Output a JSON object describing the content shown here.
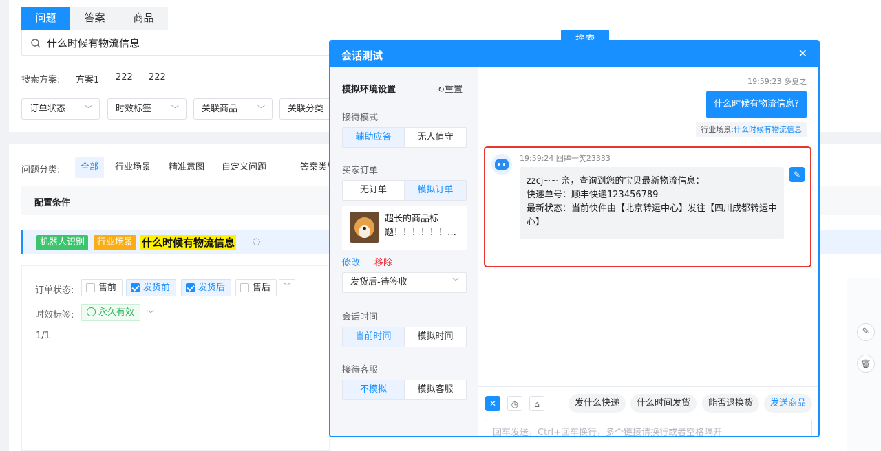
{
  "top_tabs": [
    "问题",
    "答案",
    "商品"
  ],
  "search": {
    "value": "什么时候有物流信息",
    "button_label": "搜索"
  },
  "search_plan": {
    "label": "搜索方案:",
    "items": [
      "方案1",
      "222",
      "222"
    ]
  },
  "filters": [
    "订单状态",
    "时效标签",
    "关联商品",
    "关联分类"
  ],
  "categories": {
    "label": "问题分类:",
    "items": [
      "全部",
      "行业场景",
      "精准意图",
      "自定义问题"
    ],
    "extra": "答案类型"
  },
  "config_title": "配置条件",
  "question": {
    "tags": [
      "机器人识别",
      "行业场景"
    ],
    "text": "什么时候有物流信息"
  },
  "conditions": {
    "order_label": "订单状态:",
    "order_options": [
      {
        "label": "售前",
        "checked": false
      },
      {
        "label": "发货前",
        "checked": true
      },
      {
        "label": "发货后",
        "checked": true
      },
      {
        "label": "售后",
        "checked": false
      }
    ],
    "time_label": "时效标签:",
    "time_value": "永久有效",
    "pager": "1/1"
  },
  "modal": {
    "title": "会话测试",
    "left": {
      "title": "模拟环境设置",
      "reset_label": "重置",
      "reception_mode": {
        "label": "接待模式",
        "options": [
          "辅助应答",
          "无人值守"
        ],
        "selected": 0
      },
      "buyer_order": {
        "label": "买家订单",
        "options": [
          "无订单",
          "模拟订单"
        ],
        "selected": 1
      },
      "product": {
        "title": "超长的商品标题！！！！！！…",
        "edit": "修改",
        "remove": "移除"
      },
      "order_status": "发货后-待签收",
      "session_time": {
        "label": "会话时间",
        "options": [
          "当前时间",
          "模拟时间"
        ],
        "selected": 0
      },
      "reception_service": {
        "label": "接待客服",
        "options": [
          "不模拟",
          "模拟客服"
        ],
        "selected": 0
      }
    },
    "chat": {
      "user": {
        "meta": "19:59:23 多夏之",
        "text": "什么时候有物流信息?",
        "scene_label": "行业场景:",
        "scene_value": "什么时候有物流信息"
      },
      "bot": {
        "meta": "19:59:24 回眸一笑23333",
        "lines": [
          "zzcj~~ 亲，查询到您的宝贝最新物流信息：",
          "快递单号：顺丰快递123456789",
          "最新状态：当前快件由【北京转运中心】发往【四川成都转运中心】"
        ]
      },
      "quick_replies": [
        "发什么快递",
        "什么时间发货",
        "能否退换货",
        "发送商品"
      ],
      "input_placeholder": "回车发送，Ctrl+回车换行，多个链接请换行或者空格隔开"
    }
  },
  "colors": {
    "primary": "#1890ff",
    "highlight_border": "#e8372e",
    "tag_green": "#3ec46d",
    "tag_orange": "#faad14",
    "highlight_yellow": "#fff200"
  }
}
